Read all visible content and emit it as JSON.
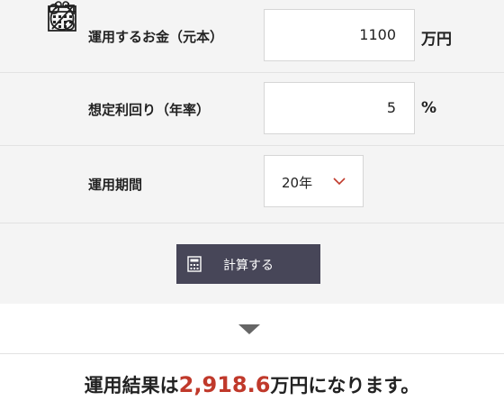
{
  "form": {
    "principal": {
      "label": "運用するお金（元本）",
      "value": "1100",
      "unit": "万円",
      "icon": "coin-purse-icon"
    },
    "rate": {
      "label": "想定利回り（年率）",
      "value": "5",
      "unit": "%",
      "icon": "percent-arrow-icon"
    },
    "period": {
      "label": "運用期間",
      "selected": "20年",
      "icon": "calendar-icon"
    }
  },
  "action": {
    "label": "計算する",
    "icon": "calculator-icon"
  },
  "result": {
    "prefix": "運用結果は",
    "amount": "2,918.6",
    "suffix": "万円になります。"
  },
  "colors": {
    "button_bg": "#474658",
    "result_amount": "#c0392b",
    "chevron": "#c0392b"
  }
}
